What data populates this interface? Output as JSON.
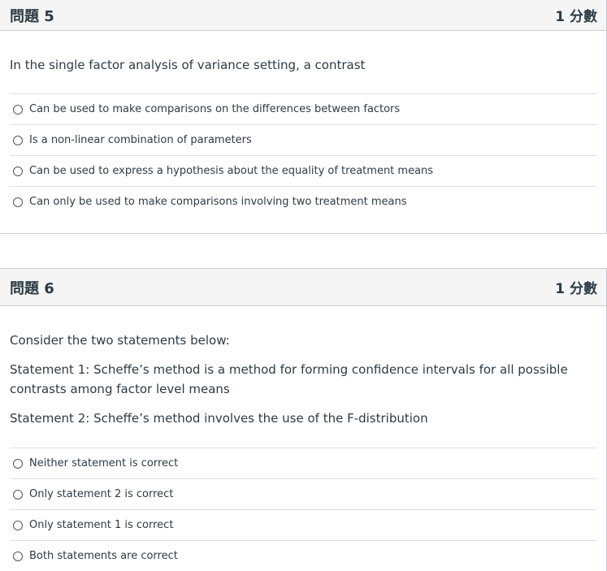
{
  "q5": {
    "title": "問題 5",
    "points": "1 分數",
    "text": "In the single factor analysis of variance setting, a contrast",
    "answers": [
      "Can be used to make comparisons on the differences between factors",
      "Is a non-linear combination of parameters",
      "Can be used to express a hypothesis about the equality of treatment means",
      "Can only be used to make comparisons involving two treatment means"
    ]
  },
  "q6": {
    "title": "問題 6",
    "points": "1 分數",
    "paragraphs": [
      "Consider the two statements below:",
      "Statement 1:  Scheffe’s method is a method for forming confidence intervals for all possible contrasts among factor level means",
      "Statement 2:  Scheffe’s method involves the use of the F-distribution"
    ],
    "answers": [
      "Neither statement is correct",
      "Only statement 2 is correct",
      "Only statement 1 is correct",
      "Both statements are correct"
    ]
  }
}
